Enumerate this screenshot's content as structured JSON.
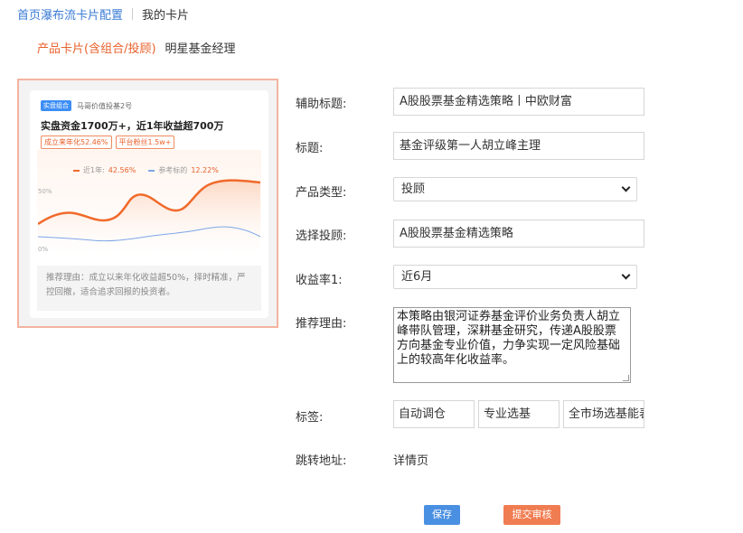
{
  "breadcrumb": {
    "parent": "首页瀑布流卡片配置",
    "current": "我的卡片"
  },
  "tabs": {
    "active": "产品卡片(含组合/投顾)",
    "other": "明星基金经理"
  },
  "preview": {
    "tag": "实盘组合",
    "manager": "马哥价值投基2号",
    "title": "实盘资金1700万+，近1年收益超700万",
    "badges": [
      "成立来年化52.46%",
      "平台粉丝1.5w+"
    ],
    "legend": {
      "series1_label": "近1年:",
      "series1_value": "42.56%",
      "series2_label": "参考标的",
      "series2_value": "12.22%"
    },
    "axis": {
      "y_top": "50%",
      "y_bottom": "0%"
    },
    "reason": "推荐理由：成立以来年化收益超50%，择时精准，严控回撤，适合追求回报的投资者。",
    "colors": {
      "series1": "#f06a2a",
      "series2": "#7ea6e6"
    }
  },
  "form": {
    "subtitle_label": "辅助标题:",
    "subtitle_value": "A股股票基金精选策略丨中欧财富",
    "title_label": "标题:",
    "title_value": "基金评级第一人胡立峰主理",
    "type_label": "产品类型:",
    "type_value": "投顾",
    "advisor_label": "选择投顾:",
    "advisor_value": "A股股票基金精选策略",
    "return_label": "收益率1:",
    "return_value": "近6月",
    "reason_label": "推荐理由:",
    "reason_value": "本策略由银河证券基金评价业务负责人胡立峰带队管理，深耕基金研究，传递A股股票方向基金专业价值，力争实现一定风险基础上的较高年化收益率。",
    "tags_label": "标签:",
    "tags": [
      "自动调仓",
      "专业选基",
      "全市场选基能表"
    ],
    "jump_label": "跳转地址:",
    "jump_value": "详情页"
  },
  "buttons": {
    "save": "保存",
    "submit": "提交审核"
  }
}
